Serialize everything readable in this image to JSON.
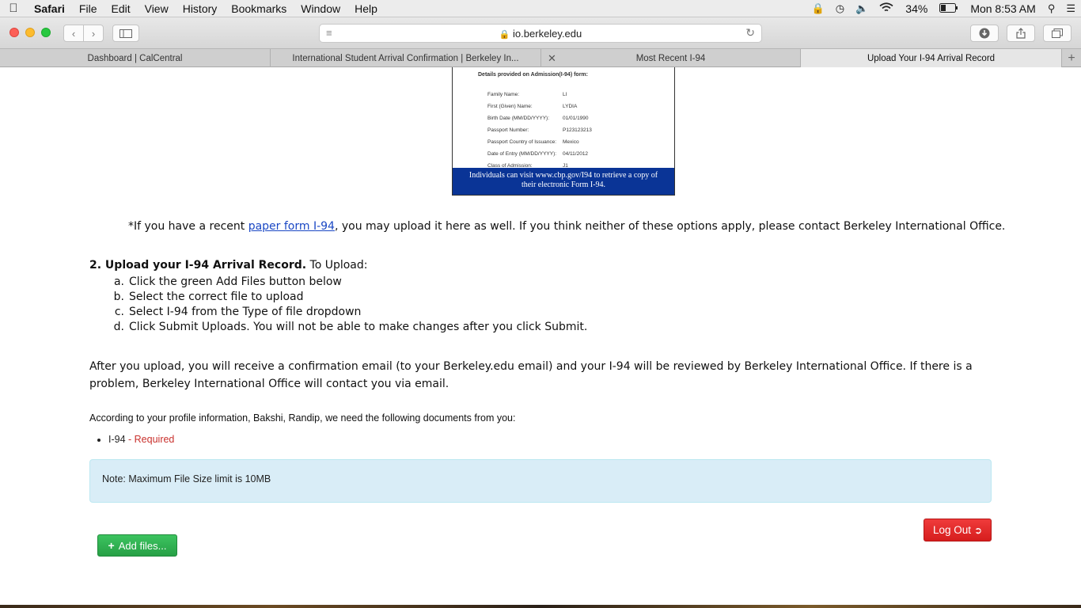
{
  "menubar": {
    "app": "Safari",
    "items": [
      "File",
      "Edit",
      "View",
      "History",
      "Bookmarks",
      "Window",
      "Help"
    ],
    "battery": "34%",
    "clock": "Mon 8:53 AM"
  },
  "toolbar": {
    "url": "io.berkeley.edu"
  },
  "tabs": [
    {
      "label": "Dashboard | CalCentral"
    },
    {
      "label": "International Student Arrival Confirmation | Berkeley In..."
    },
    {
      "label": "Most Recent I-94"
    },
    {
      "label": "Upload Your I-94 Arrival Record"
    }
  ],
  "i94_image": {
    "title": "Details provided on Admission(I-94) form:",
    "fields": [
      {
        "label": "Family Name:",
        "value": "LI"
      },
      {
        "label": "First (Given) Name:",
        "value": "LYDIA"
      },
      {
        "label": "Birth Date (MM/DD/YYYY):",
        "value": "01/01/1990"
      },
      {
        "label": "Passport Number:",
        "value": "P123123213"
      },
      {
        "label": "Passport Country of Issuance:",
        "value": "Mexico"
      },
      {
        "label": "Date of Entry (MM/DD/YYYY):",
        "value": "04/11/2012"
      },
      {
        "label": "Class of Admission:",
        "value": "J1"
      }
    ],
    "banner_line1": "Individuals can visit www.cbp.gov/I94 to retrieve a copy of",
    "banner_line2": "their electronic Form I-94."
  },
  "main": {
    "recent_prefix": "*If you have a recent ",
    "recent_link": "paper form I-94",
    "recent_suffix": ", you may upload it here as well. If you think neither of these options apply, please contact Berkeley International Office.",
    "step_heading_bold": "2. Upload your I-94 Arrival Record.",
    "step_heading_rest": " To Upload:",
    "steps": [
      {
        "letter": "a.",
        "text": "Click the green Add Files button below"
      },
      {
        "letter": "b.",
        "text": "Select the correct file to upload"
      },
      {
        "letter": "c.",
        "text": "Select I-94 from the Type of file dropdown"
      },
      {
        "letter": "d.",
        "text": "Click Submit Uploads. You will not be able to make changes after you click Submit."
      }
    ],
    "after_upload": "After you upload, you will receive a confirmation email (to your Berkeley.edu email) and your I-94 will be reviewed by Berkeley International Office. If there is a problem, Berkeley International Office will contact you via email.",
    "profile_text": "According to your profile information, Bakshi, Randip, we need the following documents from you:",
    "doc_name": "I-94",
    "doc_sep": " - ",
    "doc_status": "Required",
    "note": "Note: Maximum File Size limit is 10MB",
    "add_files_label": "Add files...",
    "logout_label": "Log Out"
  },
  "colors": {
    "link": "#1a47c4",
    "required": "#c9302c",
    "note_bg": "#d9edf7",
    "add_button": "#27a046",
    "logout_button": "#d61d1d",
    "banner": "#0a3496"
  }
}
